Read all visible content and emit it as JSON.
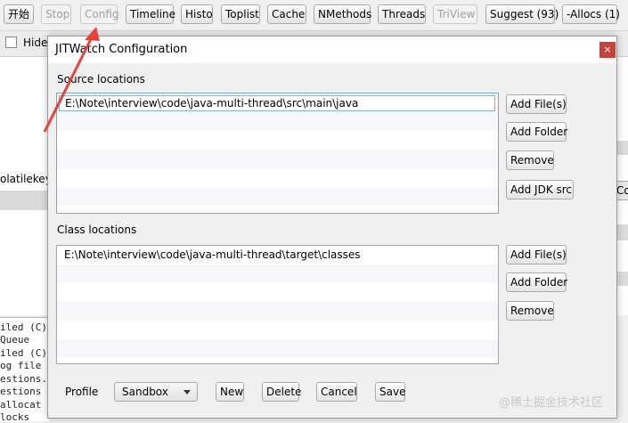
{
  "toolbar": {
    "buttons": [
      {
        "label": "开始"
      },
      {
        "label": "Stop"
      },
      {
        "label": "Config"
      },
      {
        "label": "Timeline"
      },
      {
        "label": "Histo"
      },
      {
        "label": "Toplist"
      },
      {
        "label": "Cache"
      },
      {
        "label": "NMethods"
      },
      {
        "label": "Threads"
      },
      {
        "label": "TriView"
      },
      {
        "label": "Suggest (93)"
      },
      {
        "label": "-Allocs (1)"
      }
    ]
  },
  "background": {
    "hide_label": "Hide",
    "left_text": "olatilekeyv",
    "right_button": "Co",
    "console_lines": [
      "iled (C)",
      "  Queue",
      "iled (C)",
      "og file",
      "estions.",
      "estions",
      " allocat",
      "locks"
    ]
  },
  "dialog": {
    "title": "JITWatch Configuration",
    "close_glyph": "×",
    "source": {
      "label": "Source locations",
      "items": [
        "E:\\Note\\interview\\code\\java-multi-thread\\src\\main\\java"
      ],
      "buttons": {
        "add_files": "Add File(s)",
        "add_folder": "Add Folder",
        "remove": "Remove",
        "add_jdk": "Add JDK src"
      }
    },
    "class": {
      "label": "Class locations",
      "items": [
        "E:\\Note\\interview\\code\\java-multi-thread\\target\\classes"
      ],
      "buttons": {
        "add_files": "Add File(s)",
        "add_folder": "Add Folder",
        "remove": "Remove"
      }
    },
    "footer": {
      "profile_label": "Profile",
      "profile_value": "Sandbox",
      "new": "New",
      "delete": "Delete",
      "cancel": "Cancel",
      "save": "Save"
    }
  },
  "annotation": {
    "arrow_color": "#e8443a"
  },
  "watermark": "@稀土掘金技术社区"
}
